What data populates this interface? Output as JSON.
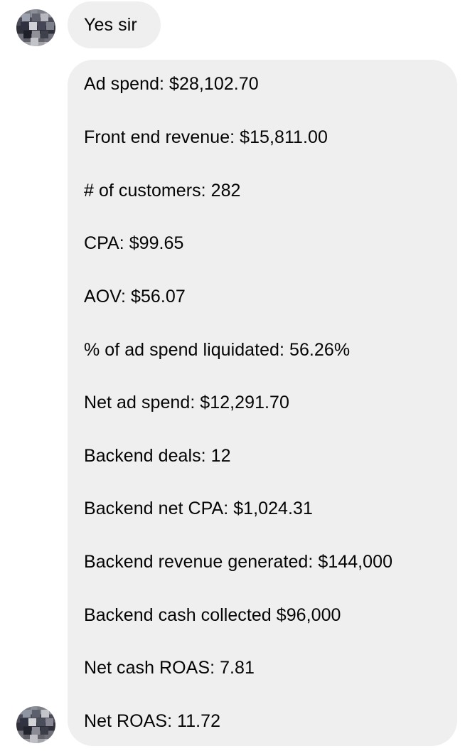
{
  "conversation": {
    "reply": "Yes sir",
    "stats": [
      "Ad spend: $28,102.70",
      "Front end revenue: $15,811.00",
      "# of customers: 282",
      "CPA: $99.65",
      "AOV: $56.07",
      "% of ad spend liquidated: 56.26%",
      "Net ad spend: $12,291.70",
      "Backend deals: 12",
      "Backend net CPA: $1,024.31",
      "Backend revenue generated: $144,000",
      "Backend cash collected $96,000",
      "Net cash ROAS: 7.81",
      "Net ROAS: 11.72"
    ]
  },
  "colors": {
    "bubble": "#efefef",
    "text": "#050505",
    "background": "#ffffff"
  },
  "icons": {
    "avatar": "user-avatar-icon"
  }
}
